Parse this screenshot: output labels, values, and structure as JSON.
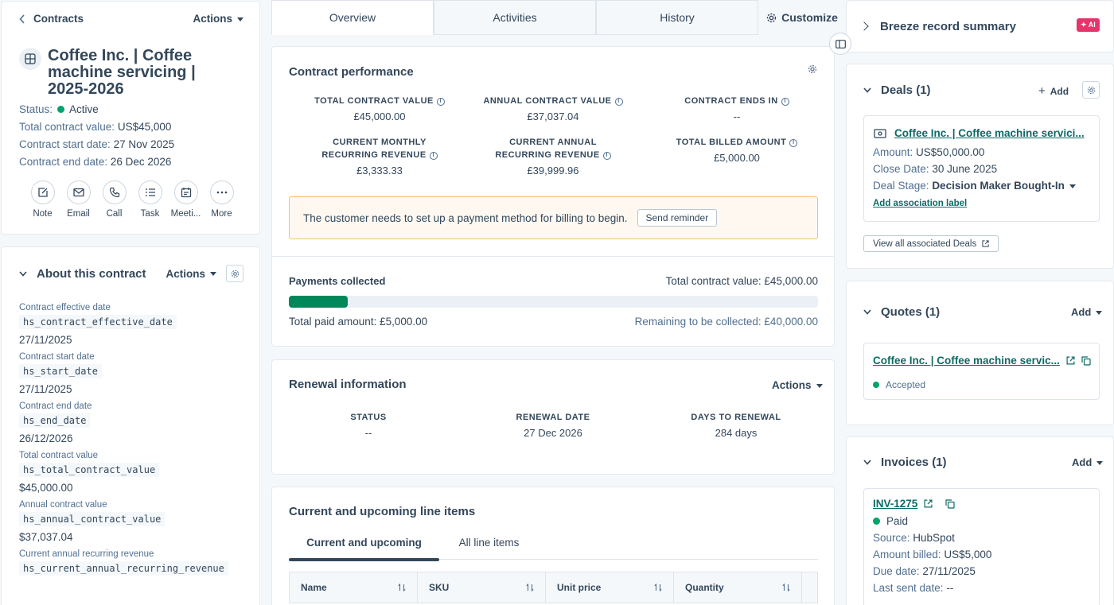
{
  "left": {
    "breadcrumb": "Contracts",
    "actions_label": "Actions",
    "record_title": "Coffee Inc. | Coffee machine servicing | 2025-2026",
    "status_label": "Status:",
    "status_value": "Active",
    "tcv_label": "Total contract value:",
    "tcv_value": "US$45,000",
    "start_label": "Contract start date:",
    "start_value": "27 Nov 2025",
    "end_label": "Contract end date:",
    "end_value": "26 Dec 2026",
    "quick_actions": [
      {
        "label": "Note",
        "icon": "note-icon"
      },
      {
        "label": "Email",
        "icon": "email-icon"
      },
      {
        "label": "Call",
        "icon": "call-icon"
      },
      {
        "label": "Task",
        "icon": "task-icon"
      },
      {
        "label": "Meeti...",
        "icon": "meeting-icon"
      },
      {
        "label": "More",
        "icon": "more-icon"
      }
    ],
    "about": {
      "title": "About this contract",
      "actions_label": "Actions",
      "properties": [
        {
          "label": "Contract effective date",
          "internal": "hs_contract_effective_date",
          "value": "27/11/2025"
        },
        {
          "label": "Contract start date",
          "internal": "hs_start_date",
          "value": "27/11/2025"
        },
        {
          "label": "Contract end date",
          "internal": "hs_end_date",
          "value": "26/12/2026"
        },
        {
          "label": "Total contract value",
          "internal": "hs_total_contract_value",
          "value": "$45,000.00"
        },
        {
          "label": "Annual contract value",
          "internal": "hs_annual_contract_value",
          "value": "$37,037.04"
        },
        {
          "label": "Current annual recurring revenue",
          "internal": "hs_current_annual_recurring_revenue",
          "value": ""
        }
      ]
    }
  },
  "tabs": {
    "overview": "Overview",
    "activities": "Activities",
    "history": "History",
    "customize": "Customize"
  },
  "performance": {
    "title": "Contract performance",
    "kpis": [
      {
        "label_1": "Total contract value",
        "label_2": "",
        "value": "£45,000.00"
      },
      {
        "label_1": "Annual contract value",
        "label_2": "",
        "value": "£37,037.04"
      },
      {
        "label_1": "Contract ends in",
        "label_2": "",
        "value": "--"
      },
      {
        "label_1": "Current monthly",
        "label_2": "recurring revenue",
        "value": "£3,333.33"
      },
      {
        "label_1": "Current annual",
        "label_2": "recurring revenue",
        "value": "£39,999.96"
      },
      {
        "label_1": "Total billed amount",
        "label_2": "",
        "value": "£5,000.00"
      }
    ],
    "alert_text": "The customer needs to set up a payment method for billing to begin.",
    "alert_button": "Send reminder"
  },
  "payments": {
    "title": "Payments collected",
    "total_label": "Total contract value: £45,000.00",
    "paid_label": "Total paid amount: £5,000.00",
    "remaining_label": "Remaining to be collected: £40,000.00",
    "progress_fraction": 0.111
  },
  "renewal": {
    "title": "Renewal information",
    "actions_label": "Actions",
    "columns": [
      {
        "label": "Status",
        "value": "--"
      },
      {
        "label": "Renewal date",
        "value": "27 Dec 2026"
      },
      {
        "label": "Days to renewal",
        "value": "284 days"
      }
    ]
  },
  "line_items": {
    "title": "Current and upcoming line items",
    "tab_current": "Current and upcoming",
    "tab_all": "All line items",
    "columns": [
      "Name",
      "SKU",
      "Unit price",
      "Quantity"
    ]
  },
  "right": {
    "summary_title": "Breeze record summary",
    "ai_badge": "AI",
    "deals": {
      "title": "Deals (1)",
      "add_label": "Add",
      "deal_name": "Coffee Inc. | Coffee machine servici...",
      "amount_label": "Amount:",
      "amount_value": "US$50,000.00",
      "close_label": "Close Date:",
      "close_value": "30 June 2025",
      "stage_label": "Deal Stage:",
      "stage_value": "Decision Maker Bought-In",
      "association_link": "Add association label",
      "view_all": "View all associated Deals"
    },
    "quotes": {
      "title": "Quotes (1)",
      "add_label": "Add",
      "quote_name": "Coffee Inc. | Coffee machine servic...",
      "status": "Accepted"
    },
    "invoices": {
      "title": "Invoices (1)",
      "add_label": "Add",
      "invoice_id": "INV-1275",
      "status": "Paid",
      "source_label": "Source:",
      "source_value": "HubSpot",
      "billed_label": "Amount billed:",
      "billed_value": "US$5,000",
      "due_label": "Due date:",
      "due_value": "27/11/2025",
      "sent_label": "Last sent date:",
      "sent_value": "--"
    }
  },
  "colors": {
    "accent_teal": "#0b6b66",
    "success_green": "#00a36c",
    "progress_green": "#00875a",
    "alert_bg": "#fef8f0",
    "alert_border": "#f5c26b",
    "ai_pink": "#e8336b"
  }
}
